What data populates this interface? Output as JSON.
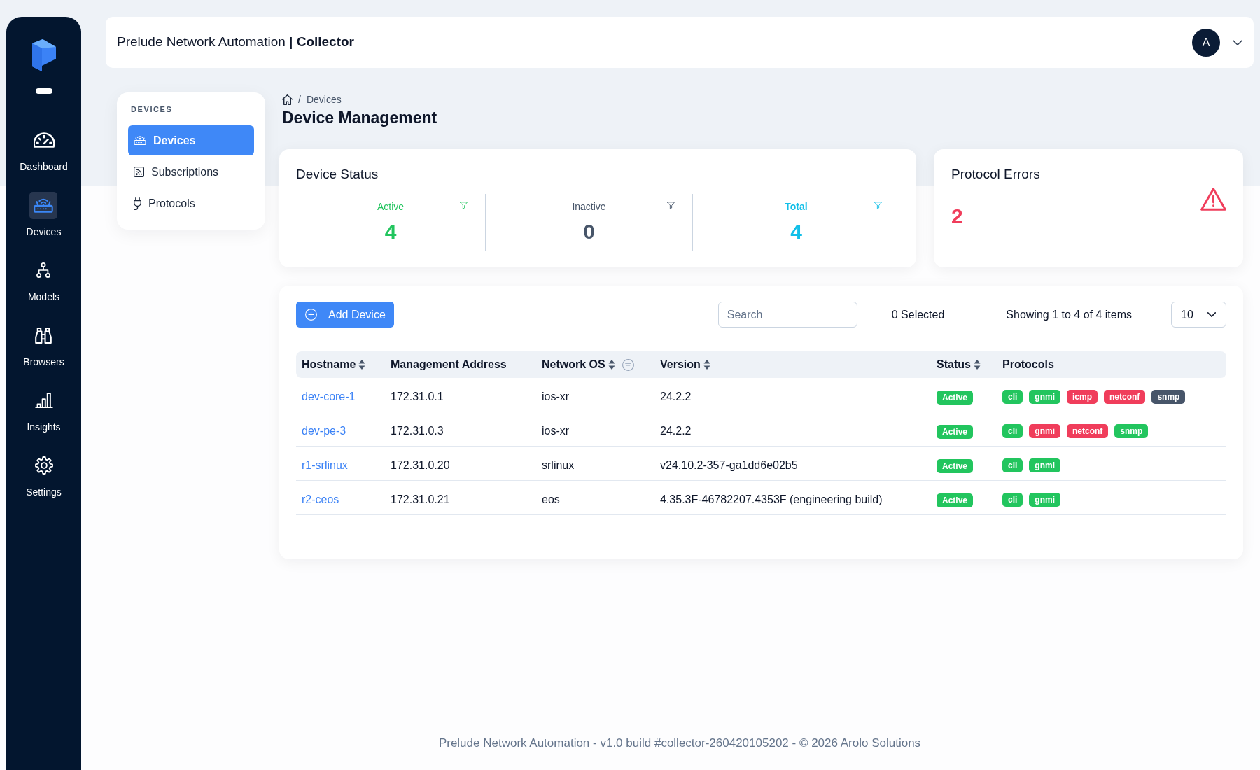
{
  "sidebar": {
    "items": [
      {
        "label": "Dashboard",
        "selected": false
      },
      {
        "label": "Devices",
        "selected": true
      },
      {
        "label": "Models",
        "selected": false
      },
      {
        "label": "Browsers",
        "selected": false
      },
      {
        "label": "Insights",
        "selected": false
      },
      {
        "label": "Settings",
        "selected": false
      }
    ]
  },
  "header": {
    "title": "Prelude Network Automation **| Collector**",
    "avatar": "A"
  },
  "subnav": {
    "heading": "DEVICES",
    "items": [
      {
        "label": "Devices",
        "selected": true
      },
      {
        "label": "Subscriptions",
        "selected": false
      },
      {
        "label": "Protocols",
        "selected": false
      }
    ]
  },
  "breadcrumb": {
    "separator": "/",
    "items": [
      "Devices"
    ]
  },
  "page_title": "Device Management",
  "device_status": {
    "title": "Device Status",
    "stats": [
      {
        "label": "Active",
        "value": "4",
        "color": "#22c55e",
        "selected": false
      },
      {
        "label": "Inactive",
        "value": "0",
        "color": "#475569",
        "selected": false
      },
      {
        "label": "Total",
        "value": "4",
        "color": "#12bfe8",
        "selected": true
      }
    ]
  },
  "protocol_errors": {
    "title": "Protocol Errors",
    "value": "2"
  },
  "toolbar": {
    "add_button": "Add Device",
    "search": {
      "placeholder": "Search"
    },
    "selected_count": "0 Selected",
    "summary": "Showing 1 to 4 of 4 items",
    "page_size": "10"
  },
  "table": {
    "columns": [
      {
        "label": "Hostname",
        "sortable": true,
        "filterable": false
      },
      {
        "label": "Management Address",
        "sortable": false,
        "filterable": false
      },
      {
        "label": "Network OS",
        "sortable": true,
        "filterable": true
      },
      {
        "label": "Version",
        "sortable": true,
        "filterable": false
      },
      {
        "label": "Status",
        "sortable": true,
        "filterable": false
      },
      {
        "label": "Protocols",
        "sortable": false,
        "filterable": false
      }
    ],
    "rows": [
      {
        "hostname": "dev-core-1",
        "address": "172.31.0.1",
        "os": "ios-xr",
        "version": "24.2.2",
        "status": "Active",
        "protocols": [
          {
            "name": "cli",
            "color": "#22c55e"
          },
          {
            "name": "gnmi",
            "color": "#22c55e"
          },
          {
            "name": "icmp",
            "color": "#f03d5b"
          },
          {
            "name": "netconf",
            "color": "#f03d5b"
          },
          {
            "name": "snmp",
            "color": "#475569"
          }
        ]
      },
      {
        "hostname": "dev-pe-3",
        "address": "172.31.0.3",
        "os": "ios-xr",
        "version": "24.2.2",
        "status": "Active",
        "protocols": [
          {
            "name": "cli",
            "color": "#22c55e"
          },
          {
            "name": "gnmi",
            "color": "#f03d5b"
          },
          {
            "name": "netconf",
            "color": "#f03d5b"
          },
          {
            "name": "snmp",
            "color": "#22c55e"
          }
        ]
      },
      {
        "hostname": "r1-srlinux",
        "address": "172.31.0.20",
        "os": "srlinux",
        "version": "v24.10.2-357-ga1dd6e02b5",
        "status": "Active",
        "protocols": [
          {
            "name": "cli",
            "color": "#22c55e"
          },
          {
            "name": "gnmi",
            "color": "#22c55e"
          }
        ]
      },
      {
        "hostname": "r2-ceos",
        "address": "172.31.0.21",
        "os": "eos",
        "version": "4.35.3F-46782207.4353F (engineering build)",
        "status": "Active",
        "protocols": [
          {
            "name": "cli",
            "color": "#22c55e"
          },
          {
            "name": "gnmi",
            "color": "#22c55e"
          }
        ]
      }
    ]
  },
  "footer": "Prelude Network Automation - v1.0 build #collector-260420105202 - © 2026 Arolo Solutions"
}
